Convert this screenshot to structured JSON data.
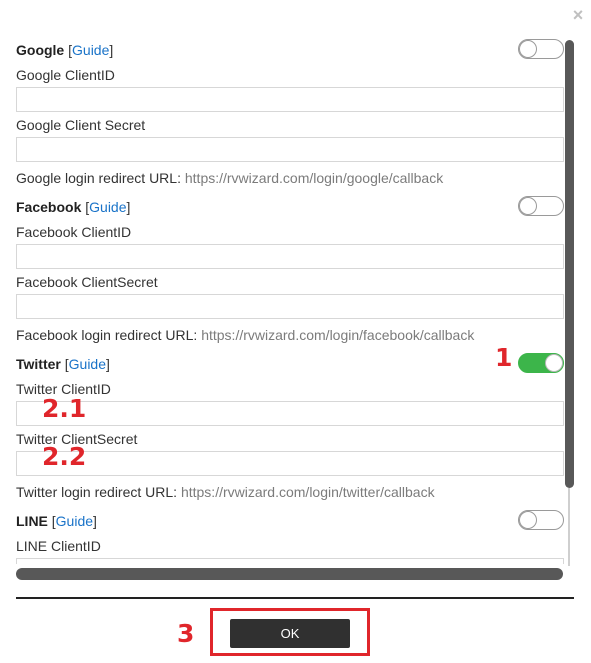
{
  "dialog": {
    "close_glyph": "×",
    "ok_label": "OK"
  },
  "providers": [
    {
      "name": "Google",
      "guide": "Guide",
      "enabled": false,
      "fields": [
        {
          "label": "Google ClientID",
          "value": ""
        },
        {
          "label": "Google Client Secret",
          "value": ""
        }
      ],
      "redirect_label": "Google login redirect URL:",
      "redirect_url": "https://rvwizard.com/login/google/callback"
    },
    {
      "name": "Facebook",
      "guide": "Guide",
      "enabled": false,
      "fields": [
        {
          "label": "Facebook ClientID",
          "value": ""
        },
        {
          "label": "Facebook ClientSecret",
          "value": ""
        }
      ],
      "redirect_label": "Facebook login redirect URL:",
      "redirect_url": "https://rvwizard.com/login/facebook/callback"
    },
    {
      "name": "Twitter",
      "guide": "Guide",
      "enabled": true,
      "fields": [
        {
          "label": "Twitter ClientID",
          "value": ""
        },
        {
          "label": "Twitter ClientSecret",
          "value": ""
        }
      ],
      "redirect_label": "Twitter login redirect URL:",
      "redirect_url": "https://rvwizard.com/login/twitter/callback"
    },
    {
      "name": "LINE",
      "guide": "Guide",
      "enabled": false,
      "fields": [
        {
          "label": "LINE ClientID",
          "value": ""
        }
      ]
    }
  ],
  "annotations": {
    "toggle_marker": "1",
    "clientid_marker": "2.1",
    "secret_marker": "2.2",
    "ok_marker": "3"
  },
  "colors": {
    "accent_red": "#e0262b",
    "toggle_on": "#3cb54a",
    "link": "#1a73c8",
    "button_dark": "#303030"
  }
}
